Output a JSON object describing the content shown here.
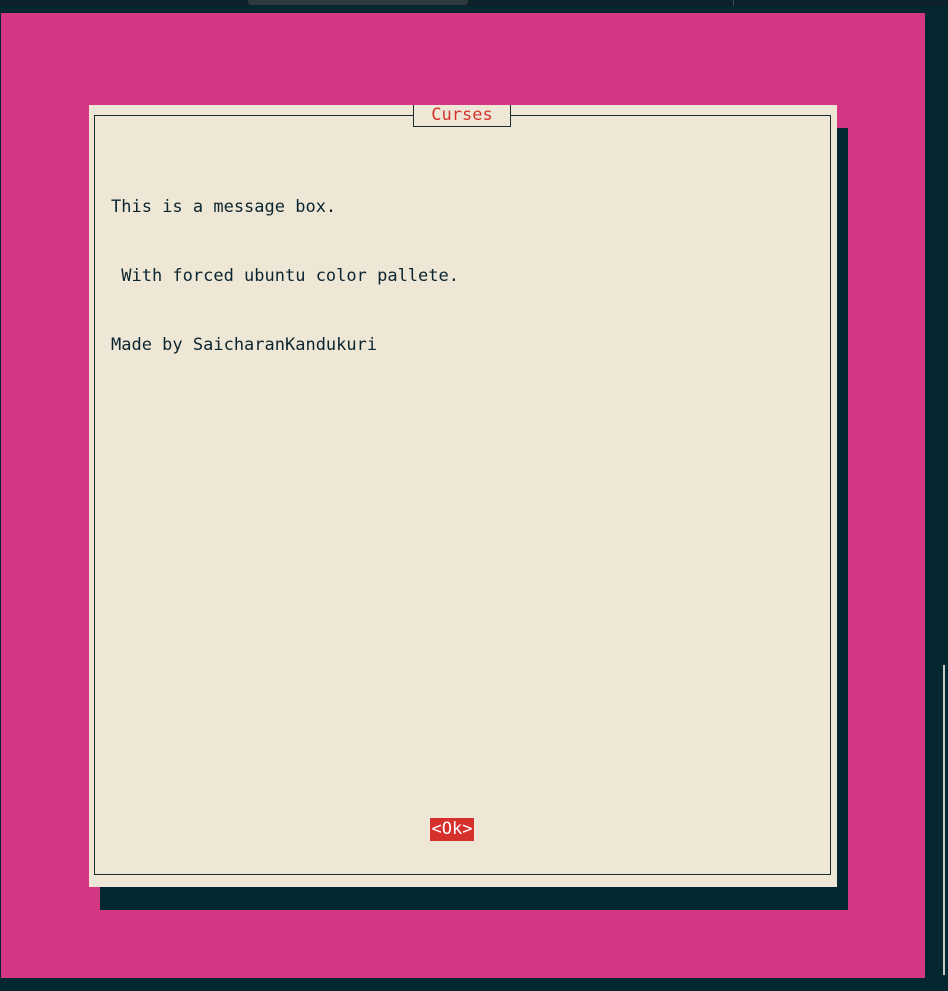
{
  "dialog": {
    "title": "Curses",
    "lines": [
      "This is a message box.",
      " With forced ubuntu color pallete.",
      "Made by SaicharanKandukuri"
    ],
    "ok_label": "<Ok>"
  },
  "colors": {
    "desktop": "#d43784",
    "terminal_bg": "#042730",
    "dialog_bg": "#eee7d5",
    "shadow": "#032832",
    "title_text": "#d6332e",
    "message_text": "#0b2530",
    "button_bg": "#d6302c",
    "button_text": "#ffffff"
  }
}
